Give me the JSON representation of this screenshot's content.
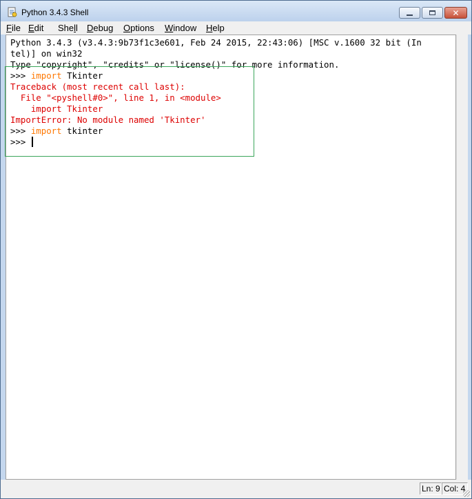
{
  "window": {
    "title": "Python 3.4.3 Shell",
    "icon": "python-idle-icon",
    "controls": {
      "minimize": "minimize-icon",
      "maximize": "maximize-icon",
      "close": "✕"
    }
  },
  "menu": [
    {
      "mnemonic": "F",
      "rest": "ile"
    },
    {
      "mnemonic": "E",
      "rest": "dit"
    },
    {
      "pre": "She",
      "mnemonic": "l",
      "rest": "l"
    },
    {
      "mnemonic": "D",
      "rest": "ebug"
    },
    {
      "mnemonic": "O",
      "rest": "ptions"
    },
    {
      "mnemonic": "W",
      "rest": "indow"
    },
    {
      "mnemonic": "H",
      "rest": "elp"
    }
  ],
  "shell": {
    "banner1": "Python 3.4.3 (v3.4.3:9b73f1c3e601, Feb 24 2015, 22:43:06) [MSC v.1600 32 bit (In",
    "banner2": "tel)] on win32",
    "banner3": "Type \"copyright\", \"credits\" or \"license()\" for more information.",
    "prompt": ">>> ",
    "keyword": "import",
    "cmd1_arg": " Tkinter",
    "tb1": "Traceback (most recent call last):",
    "tb2": "  File \"<pyshell#0>\", line 1, in <module>",
    "tb3": "    import Tkinter",
    "tb4": "ImportError: No module named 'Tkinter'",
    "cmd2_arg": " tkinter",
    "prompt_last": ">>> "
  },
  "status": {
    "line": "Ln: 9",
    "col": "Col: 4"
  },
  "colors": {
    "keyword": "#ff7700",
    "error": "#dd0000",
    "highlight_box": "#3aa55a"
  }
}
